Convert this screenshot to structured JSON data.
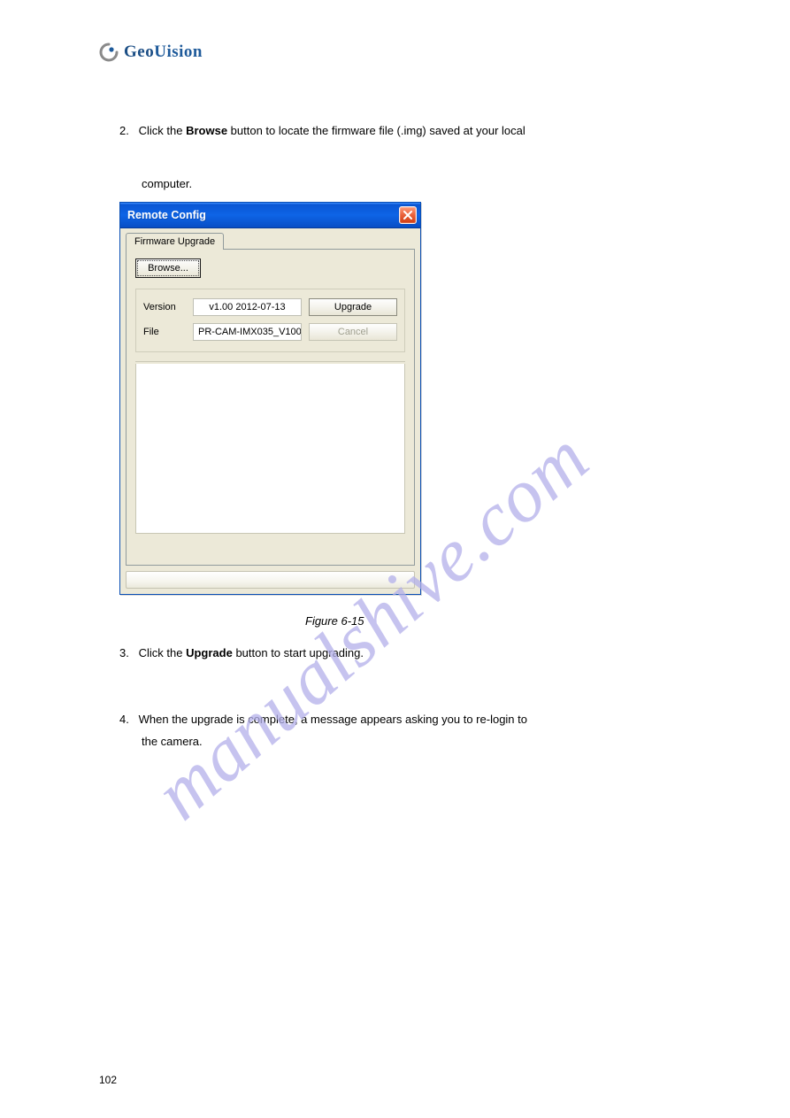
{
  "brand": {
    "name_part1": "Geo",
    "name_part2": "Uision"
  },
  "steps": {
    "s2_prefix": "2.",
    "s2_a": "Click the ",
    "s2_browse": "Browse",
    "s2_b": " button to locate the firmware file (.img) saved at your local",
    "s2_cont": "computer.",
    "s3_prefix": "3.",
    "s3_a": "Click the ",
    "s3_upgrade": "Upgrade",
    "s3_b": " button to start upgrading.",
    "s4_prefix": "4.",
    "s4_a": "When the upgrade is complete, a message appears asking you to re-login to",
    "s4_b": "the camera."
  },
  "dialog": {
    "title": "Remote Config",
    "tab": "Firmware Upgrade",
    "browse": "Browse...",
    "version_label": "Version",
    "version_value": "v1.00 2012-07-13",
    "upgrade": "Upgrade",
    "file_label": "File",
    "file_value": "PR-CAM-IMX035_V100_",
    "cancel": "Cancel"
  },
  "figure": "Figure 6-15",
  "watermark": "manualshive.com",
  "page_number": "102"
}
